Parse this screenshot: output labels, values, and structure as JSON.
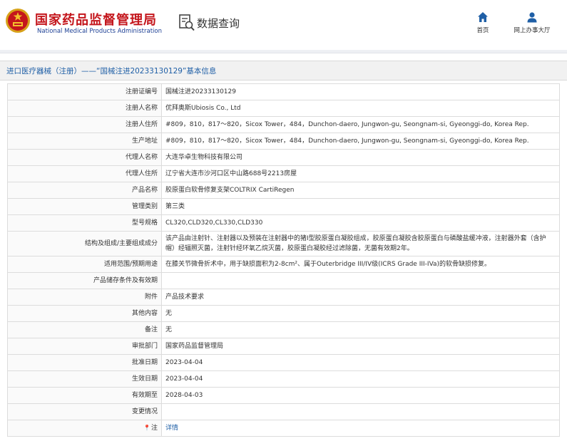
{
  "header": {
    "logo_cn": "国家药品监督管理局",
    "logo_en": "National Medical Products Administration",
    "query_label": "数据查询",
    "nav": [
      {
        "label": "首页",
        "icon": "home-icon"
      },
      {
        "label": "网上办事大厅",
        "icon": "user-icon"
      }
    ]
  },
  "title": "进口医疗器械（注册）——“国械注进20233130129”基本信息",
  "rows": [
    {
      "label": "注册证编号",
      "value": "国械注进20233130129"
    },
    {
      "label": "注册人名称",
      "value": "优拜奥斯Ubiosis Co., Ltd"
    },
    {
      "label": "注册人住所",
      "value": "#809，810，817～820，Sicox Tower，484，Dunchon-daero, Jungwon-gu, Seongnam-si, Gyeonggi-do, Korea Rep."
    },
    {
      "label": "生产地址",
      "value": "#809，810，817～820，Sicox Tower，484，Dunchon-daero, Jungwon-gu, Seongnam-si, Gyeonggi-do, Korea Rep."
    },
    {
      "label": "代理人名称",
      "value": "大连华卓生物科技有限公司"
    },
    {
      "label": "代理人住所",
      "value": "辽宁省大连市沙河口区中山路688号2213房屋"
    },
    {
      "label": "产品名称",
      "value": "胶原蛋白软骨修复支架COLTRIX CartiRegen"
    },
    {
      "label": "管理类别",
      "value": "第三类"
    },
    {
      "label": "型号规格",
      "value": "CL320,CLD320,CL330,CLD330"
    },
    {
      "label": "结构及组成/主要组成成分",
      "value": "该产品由注射针、注射器以及预装在注射器中的猪I型胶原蛋白凝胶组成，胶原蛋白凝胶含胶原蛋白与磷酸盐缓冲液，注射器外套（含护帽）经辐照灭菌，注射针经环氧乙烷灭菌，胶原蛋白凝胶经过滤除菌，无菌有效期2年。",
      "tall": true
    },
    {
      "label": "适用范围/预期用途",
      "value": "在膝关节微骨折术中，用于缺损面积为2-8cm²、属于Outerbridge III/IV级(ICRS Grade III-IVa)的软骨缺损修复。"
    },
    {
      "label": "产品储存条件及有效期",
      "value": ""
    },
    {
      "label": "附件",
      "value": "产品技术要求"
    },
    {
      "label": "其他内容",
      "value": "无"
    },
    {
      "label": "备注",
      "value": "无"
    },
    {
      "label": "审批部门",
      "value": "国家药品监督管理局"
    },
    {
      "label": "批准日期",
      "value": "2023-04-04"
    },
    {
      "label": "生效日期",
      "value": "2023-04-04"
    },
    {
      "label": "有效期至",
      "value": "2028-04-03"
    },
    {
      "label": "变更情况",
      "value": ""
    },
    {
      "label": "注",
      "value": "详情",
      "pin": "📍",
      "link": true
    }
  ]
}
